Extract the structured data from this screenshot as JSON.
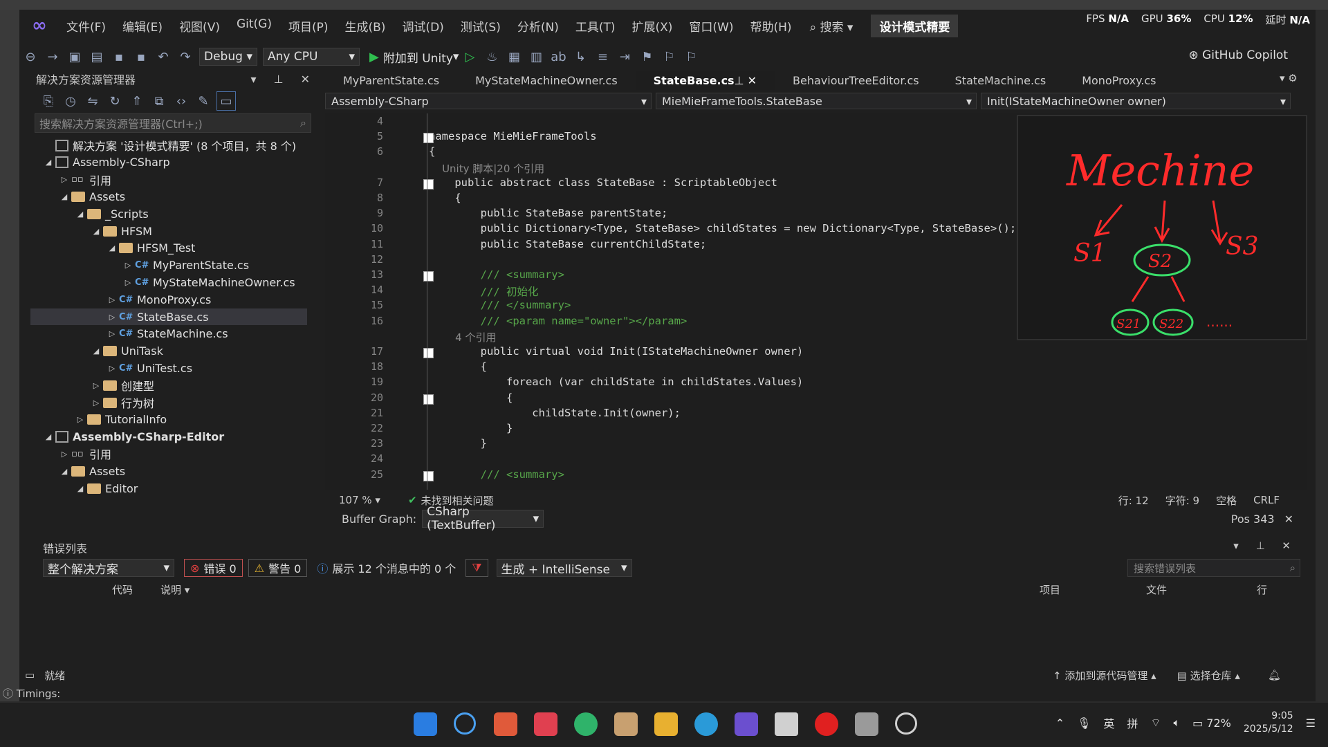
{
  "menu": [
    "文件(F)",
    "编辑(E)",
    "视图(V)",
    "Git(G)",
    "项目(P)",
    "生成(B)",
    "调试(D)",
    "测试(S)",
    "分析(N)",
    "工具(T)",
    "扩展(X)",
    "窗口(W)",
    "帮助(H)"
  ],
  "search_label": "搜索",
  "solution_title": "设计模式精要",
  "perf": {
    "fps_label": "FPS",
    "fps": "N/A",
    "gpu_label": "GPU",
    "gpu": "36%",
    "cpu_label": "CPU",
    "cpu": "12%",
    "latency_label": "延时",
    "latency": "N/A"
  },
  "toolbar": {
    "config": "Debug",
    "platform": "Any CPU",
    "attach": "附加到 Unity",
    "copilot": "GitHub Copilot"
  },
  "solution_explorer": {
    "title": "解决方案资源管理器",
    "search_placeholder": "搜索解决方案资源管理器(Ctrl+;)",
    "tree": [
      {
        "label": "解决方案 '设计模式精要' (8 个项目，共 8 个)",
        "kind": "solution",
        "depth": 0,
        "exp": ""
      },
      {
        "label": "Assembly-CSharp",
        "kind": "proj",
        "depth": 0,
        "exp": "◢"
      },
      {
        "label": "引用",
        "kind": "ref",
        "depth": 1,
        "exp": "▷"
      },
      {
        "label": "Assets",
        "kind": "folder",
        "depth": 1,
        "exp": "◢"
      },
      {
        "label": "_Scripts",
        "kind": "folder",
        "depth": 2,
        "exp": "◢"
      },
      {
        "label": "HFSM",
        "kind": "folder",
        "depth": 3,
        "exp": "◢"
      },
      {
        "label": "HFSM_Test",
        "kind": "folder",
        "depth": 4,
        "exp": "◢"
      },
      {
        "label": "MyParentState.cs",
        "kind": "cs",
        "depth": 5,
        "exp": "▷"
      },
      {
        "label": "MyStateMachineOwner.cs",
        "kind": "cs",
        "depth": 5,
        "exp": "▷"
      },
      {
        "label": "MonoProxy.cs",
        "kind": "cs",
        "depth": 4,
        "exp": "▷"
      },
      {
        "label": "StateBase.cs",
        "kind": "cs",
        "depth": 4,
        "exp": "▷",
        "selected": true
      },
      {
        "label": "StateMachine.cs",
        "kind": "cs",
        "depth": 4,
        "exp": "▷"
      },
      {
        "label": "UniTask",
        "kind": "folder",
        "depth": 3,
        "exp": "◢"
      },
      {
        "label": "UniTest.cs",
        "kind": "cs",
        "depth": 4,
        "exp": "▷"
      },
      {
        "label": "创建型",
        "kind": "folder",
        "depth": 3,
        "exp": "▷"
      },
      {
        "label": "行为树",
        "kind": "folder",
        "depth": 3,
        "exp": "▷"
      },
      {
        "label": "TutorialInfo",
        "kind": "folder",
        "depth": 2,
        "exp": "▷"
      },
      {
        "label": "Assembly-CSharp-Editor",
        "kind": "proj",
        "depth": 0,
        "exp": "◢",
        "bold": true
      },
      {
        "label": "引用",
        "kind": "ref",
        "depth": 1,
        "exp": "▷"
      },
      {
        "label": "Assets",
        "kind": "folder",
        "depth": 1,
        "exp": "◢"
      },
      {
        "label": "Editor",
        "kind": "folder",
        "depth": 2,
        "exp": "◢"
      }
    ]
  },
  "tabs": [
    "MyParentState.cs",
    "MyStateMachineOwner.cs",
    "StateBase.cs",
    "BehaviourTreeEditor.cs",
    "StateMachine.cs",
    "MonoProxy.cs"
  ],
  "active_tab": "StateBase.cs",
  "navbar": {
    "project": "Assembly-CSharp",
    "type": "MieMieFrameTools.StateBase",
    "member": "Init(IStateMachineOwner owner)"
  },
  "code": [
    {
      "n": "4",
      "t": ""
    },
    {
      "n": "5",
      "t": "namespace MieMieFrameTools"
    },
    {
      "n": "6",
      "t": "{"
    },
    {
      "n": "",
      "t": "    Unity 脚本|20 个引用",
      "ref": true
    },
    {
      "n": "7",
      "t": "    public abstract class StateBase : ScriptableObject"
    },
    {
      "n": "8",
      "t": "    {"
    },
    {
      "n": "9",
      "t": "        public StateBase parentState;"
    },
    {
      "n": "10",
      "t": "        public Dictionary<Type, StateBase> childStates = new Dictionary<Type, StateBase>();"
    },
    {
      "n": "11",
      "t": "        public StateBase currentChildState;"
    },
    {
      "n": "12",
      "t": ""
    },
    {
      "n": "13",
      "t": "        /// <summary>",
      "cm": true
    },
    {
      "n": "14",
      "t": "        /// 初始化",
      "cm": true
    },
    {
      "n": "15",
      "t": "        /// </summary>",
      "cm": true
    },
    {
      "n": "16",
      "t": "        /// <param name=\"owner\"></param>",
      "cm": true
    },
    {
      "n": "",
      "t": "        4 个引用",
      "ref": true
    },
    {
      "n": "17",
      "t": "        public virtual void Init(IStateMachineOwner owner)"
    },
    {
      "n": "18",
      "t": "        {"
    },
    {
      "n": "19",
      "t": "            foreach (var childState in childStates.Values)"
    },
    {
      "n": "20",
      "t": "            {"
    },
    {
      "n": "21",
      "t": "                childState.Init(owner);"
    },
    {
      "n": "22",
      "t": "            }"
    },
    {
      "n": "23",
      "t": "        }"
    },
    {
      "n": "24",
      "t": ""
    },
    {
      "n": "25",
      "t": "        /// <summary>",
      "cm": true
    }
  ],
  "drawing": {
    "title": "Mechine",
    "labels": [
      "S1",
      "S2",
      "S3",
      "S21",
      "S22",
      "......"
    ]
  },
  "editor_status": {
    "zoom": "107 %",
    "issues": "未找到相关问题",
    "line": "行: 12",
    "char": "字符: 9",
    "spaces": "空格",
    "eol": "CRLF"
  },
  "buffer": {
    "label": "Buffer Graph:",
    "value": "CSharp (TextBuffer)",
    "pos": "Pos 343"
  },
  "error_list": {
    "title": "错误列表",
    "scope": "整个解决方案",
    "errors": "错误 0",
    "warnings": "警告 0",
    "messages": "展示 12 个消息中的 0 个",
    "source": "生成 + IntelliSense",
    "search_placeholder": "搜索错误列表",
    "col_code": "代码",
    "col_desc": "说明",
    "col_project": "项目",
    "col_file": "文件",
    "col_line": "行"
  },
  "status": {
    "ready": "就绪",
    "add_source": "添加到源代码管理",
    "select_repo": "选择仓库",
    "timings": "Timings:"
  },
  "tray": {
    "ime1": "英",
    "ime2": "拼",
    "battery": "72%",
    "time": "9:05",
    "date": "2025/5/12"
  },
  "colors": {
    "accent": "#8a6cf0",
    "selection": "#37373d",
    "error": "#e04040",
    "warning": "#e0b030",
    "drawing_ink": "#ff2b2b",
    "drawing_green": "#3adf6a"
  }
}
